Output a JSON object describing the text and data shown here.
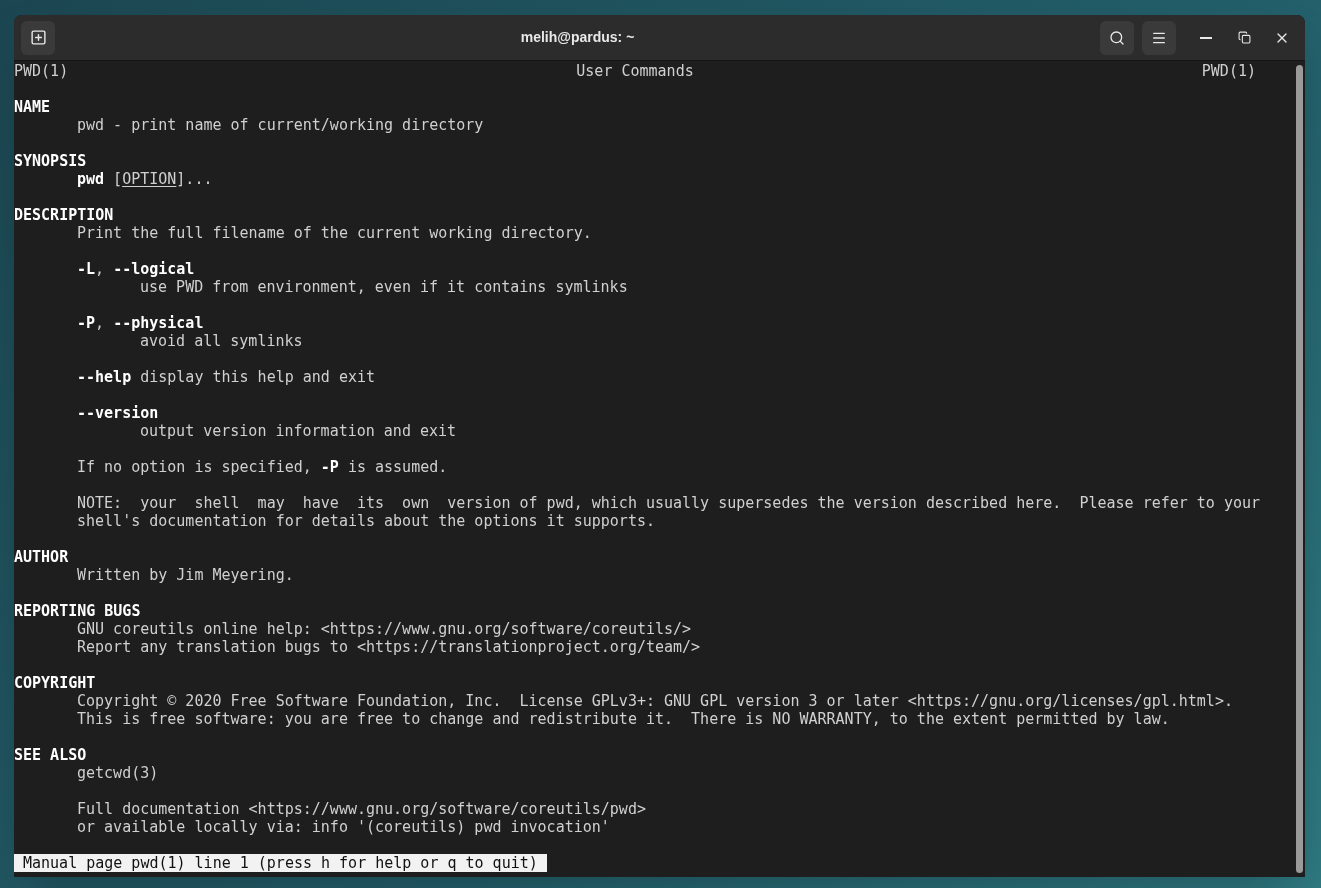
{
  "window": {
    "title": "melih@pardus: ~"
  },
  "man": {
    "header": {
      "left": "PWD(1)",
      "center": "User Commands",
      "right": "PWD(1)"
    },
    "sections": [
      {
        "title": "NAME",
        "blocks": [
          {
            "kind": "para",
            "lines": [
              [
                {
                  "text": "pwd - print name of current/working directory"
                }
              ]
            ]
          }
        ]
      },
      {
        "title": "SYNOPSIS",
        "blocks": [
          {
            "kind": "para",
            "lines": [
              [
                {
                  "text": "pwd",
                  "kind": "bold"
                },
                {
                  "text": " ["
                },
                {
                  "text": "OPTION",
                  "kind": "underline"
                },
                {
                  "text": "]..."
                }
              ]
            ]
          }
        ]
      },
      {
        "title": "DESCRIPTION",
        "blocks": [
          {
            "kind": "para",
            "lines": [
              [
                {
                  "text": "Print the full filename of the current working directory."
                }
              ]
            ]
          },
          {
            "kind": "option",
            "lines": [
              [
                {
                  "text": "-L",
                  "kind": "bold"
                },
                {
                  "text": ", "
                },
                {
                  "text": "--logical",
                  "kind": "bold"
                }
              ],
              [
                {
                  "text": "use PWD from environment, even if it contains symlinks"
                }
              ]
            ]
          },
          {
            "kind": "option",
            "lines": [
              [
                {
                  "text": "-P",
                  "kind": "bold"
                },
                {
                  "text": ", "
                },
                {
                  "text": "--physical",
                  "kind": "bold"
                }
              ],
              [
                {
                  "text": "avoid all symlinks"
                }
              ]
            ]
          },
          {
            "kind": "para",
            "lines": [
              [
                {
                  "text": "--help",
                  "kind": "bold"
                },
                {
                  "text": " display this help and exit"
                }
              ]
            ]
          },
          {
            "kind": "option",
            "lines": [
              [
                {
                  "text": "--version",
                  "kind": "bold"
                }
              ],
              [
                {
                  "text": "output version information and exit"
                }
              ]
            ]
          },
          {
            "kind": "para",
            "lines": [
              [
                {
                  "text": "If no option is specified, "
                },
                {
                  "text": "-P",
                  "kind": "bold"
                },
                {
                  "text": " is assumed."
                }
              ]
            ]
          },
          {
            "kind": "para",
            "lines": [
              [
                {
                  "text": "NOTE:  your  shell  may  have  its  own  version of pwd, which usually supersedes the version described here.  Please refer to your"
                }
              ],
              [
                {
                  "text": "shell's documentation for details about the options it supports."
                }
              ]
            ]
          }
        ]
      },
      {
        "title": "AUTHOR",
        "blocks": [
          {
            "kind": "para",
            "lines": [
              [
                {
                  "text": "Written by Jim Meyering."
                }
              ]
            ]
          }
        ]
      },
      {
        "title": "REPORTING BUGS",
        "blocks": [
          {
            "kind": "para",
            "lines": [
              [
                {
                  "text": "GNU coreutils online help: <https://www.gnu.org/software/coreutils/>"
                }
              ],
              [
                {
                  "text": "Report any translation bugs to <https://translationproject.org/team/>"
                }
              ]
            ]
          }
        ]
      },
      {
        "title": "COPYRIGHT",
        "blocks": [
          {
            "kind": "para",
            "lines": [
              [
                {
                  "text": "Copyright © 2020 Free Software Foundation, Inc.  License GPLv3+: GNU GPL version 3 or later <https://gnu.org/licenses/gpl.html>."
                }
              ],
              [
                {
                  "text": "This is free software: you are free to change and redistribute it.  There is NO WARRANTY, to the extent permitted by law."
                }
              ]
            ]
          }
        ]
      },
      {
        "title": "SEE ALSO",
        "blocks": [
          {
            "kind": "para",
            "lines": [
              [
                {
                  "text": "getcwd(3)"
                }
              ]
            ]
          },
          {
            "kind": "para",
            "lines": [
              [
                {
                  "text": "Full documentation <https://www.gnu.org/software/coreutils/pwd>"
                }
              ],
              [
                {
                  "text": "or available locally via: info '(coreutils) pwd invocation'"
                }
              ]
            ]
          }
        ]
      }
    ],
    "status": "Manual page pwd(1) line 1 (press h for help or q to quit)"
  }
}
